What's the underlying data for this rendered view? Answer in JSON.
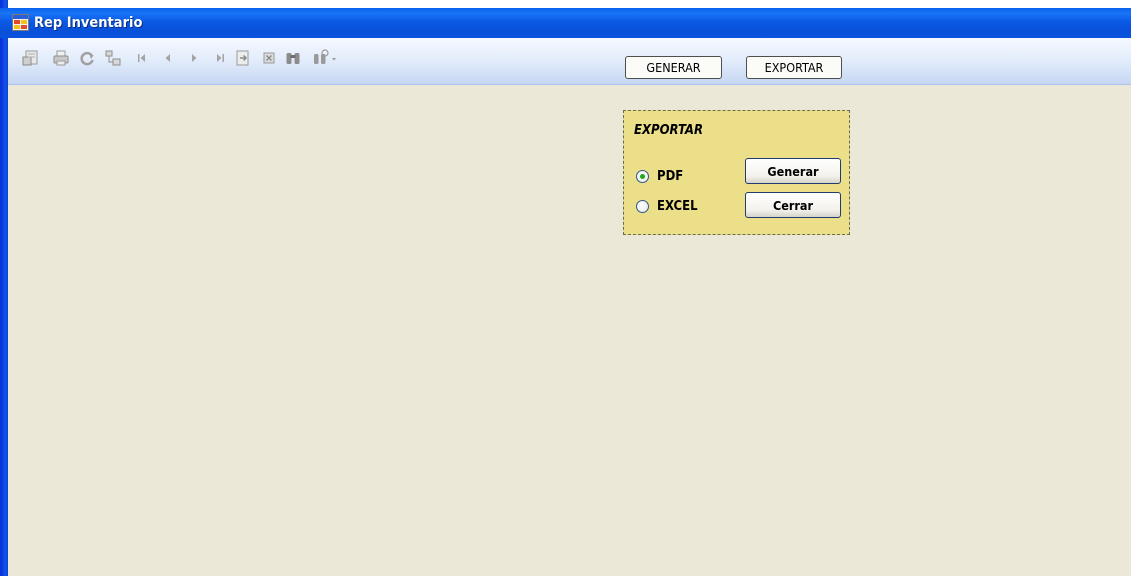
{
  "window": {
    "title": "Rep Inventario"
  },
  "toolbar": {
    "icons": [
      "export-report-icon",
      "print-icon",
      "refresh-icon",
      "toggle-group-tree-icon",
      "first-page-icon",
      "previous-page-icon",
      "next-page-icon",
      "last-page-icon",
      "go-to-page-icon",
      "stop-icon",
      "find-icon",
      "zoom-icon"
    ],
    "generar_label": "GENERAR",
    "exportar_label": "EXPORTAR"
  },
  "export_panel": {
    "title": "EXPORTAR",
    "options": [
      {
        "label": "PDF",
        "checked": true
      },
      {
        "label": "EXCEL",
        "checked": false
      }
    ],
    "generar_label": "Generar",
    "cerrar_label": "Cerrar"
  },
  "colors": {
    "titlebar": "#0b58e2",
    "content_background": "#ebe8d8",
    "panel_background": "#ebdf89",
    "radio_dot": "#1ea81e"
  }
}
